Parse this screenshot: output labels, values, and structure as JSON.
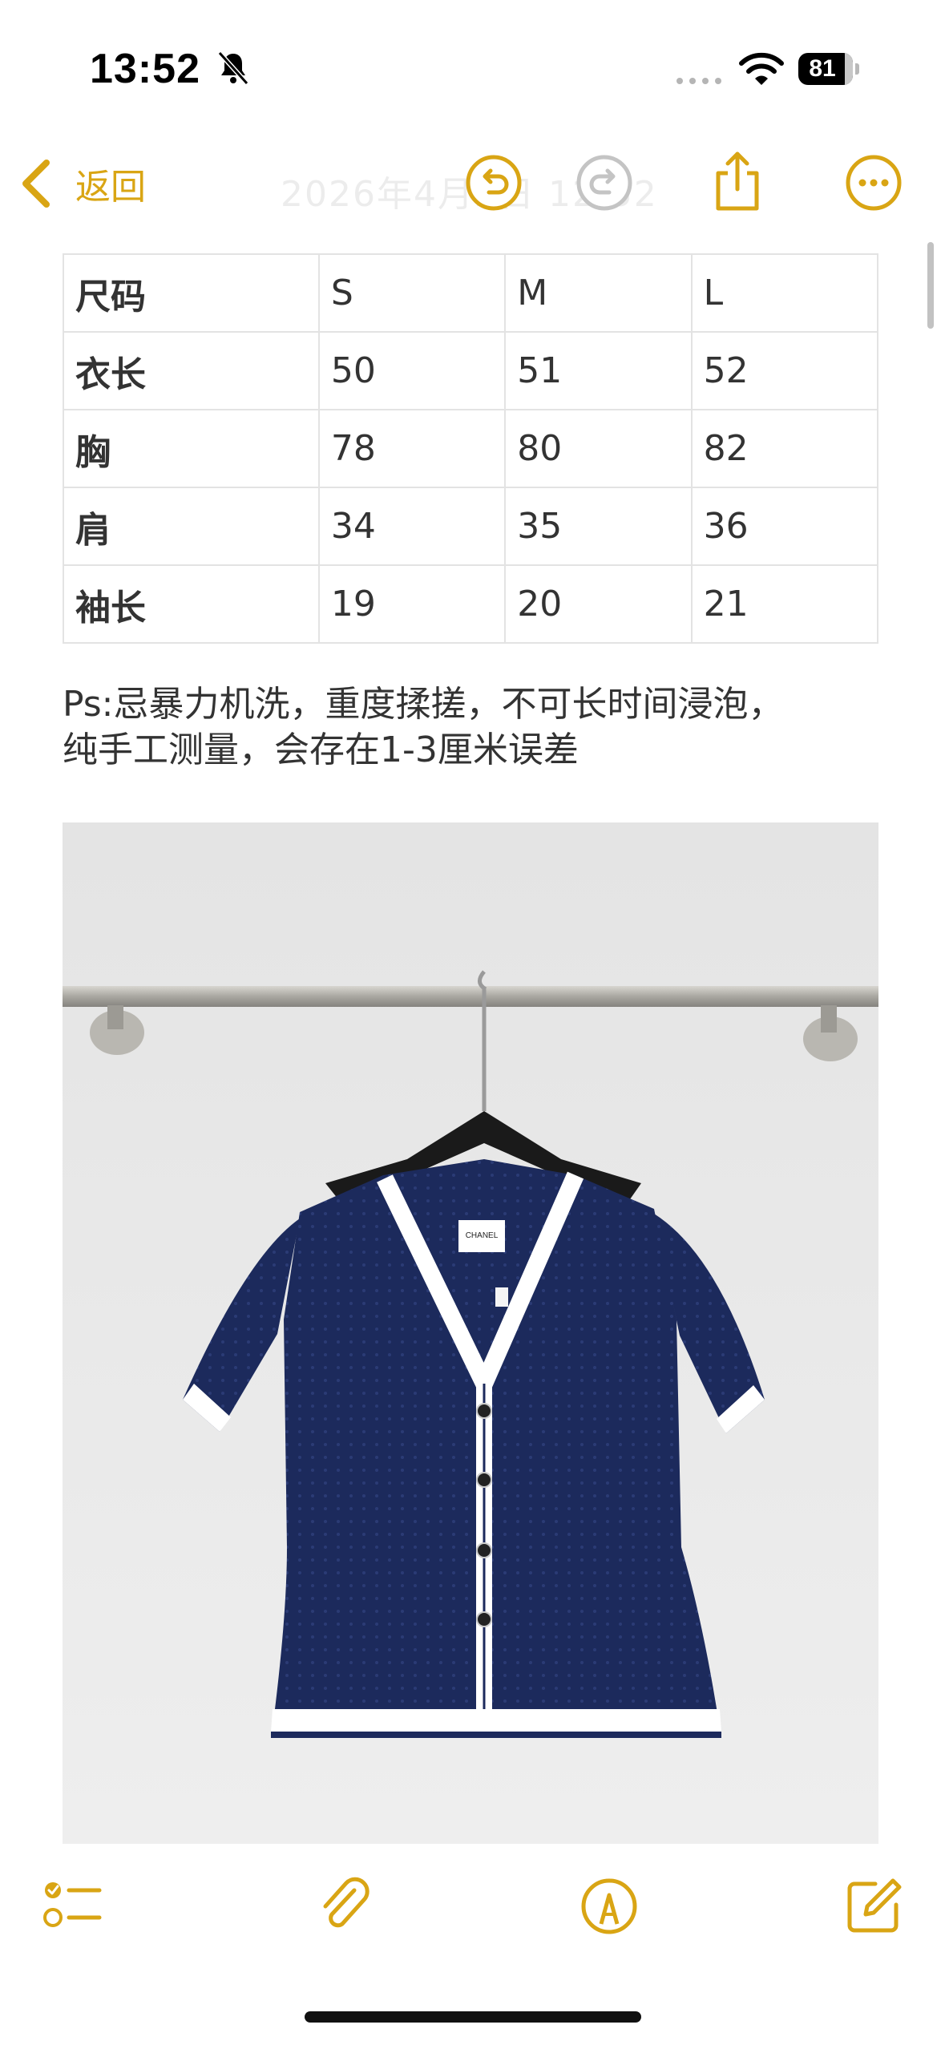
{
  "status_bar": {
    "time": "13:52",
    "battery": "81",
    "icons": [
      "bell-slash-icon",
      "signal-dots-icon",
      "wifi-icon",
      "battery-icon"
    ]
  },
  "nav": {
    "back_label": "返回",
    "title": "2026年4月2日 12:52",
    "icons": [
      "undo-icon",
      "redo-icon",
      "share-icon",
      "more-icon"
    ]
  },
  "size_table": {
    "header": [
      "尺码",
      "S",
      "M",
      "L"
    ],
    "rows": [
      [
        "衣长",
        "50",
        "51",
        "52"
      ],
      [
        "胸",
        "78",
        "80",
        "82"
      ],
      [
        "肩",
        "34",
        "35",
        "36"
      ],
      [
        "袖长",
        "19",
        "20",
        "21"
      ]
    ]
  },
  "note": {
    "line1": "Ps:忌暴力机洗，重度揉搓，不可长时间浸泡，",
    "line2": "纯手工测量，会存在1-3厘米误差"
  },
  "photo": {
    "label_text": "CHANEL"
  },
  "toolbar": {
    "icons": [
      "checklist-icon",
      "paperclip-icon",
      "markup-pen-icon",
      "compose-icon"
    ]
  },
  "colors": {
    "accent": "#D9A514",
    "garment": "#1C2A5C",
    "trim": "#FFFFFF",
    "table_border": "#E3E3E3"
  }
}
